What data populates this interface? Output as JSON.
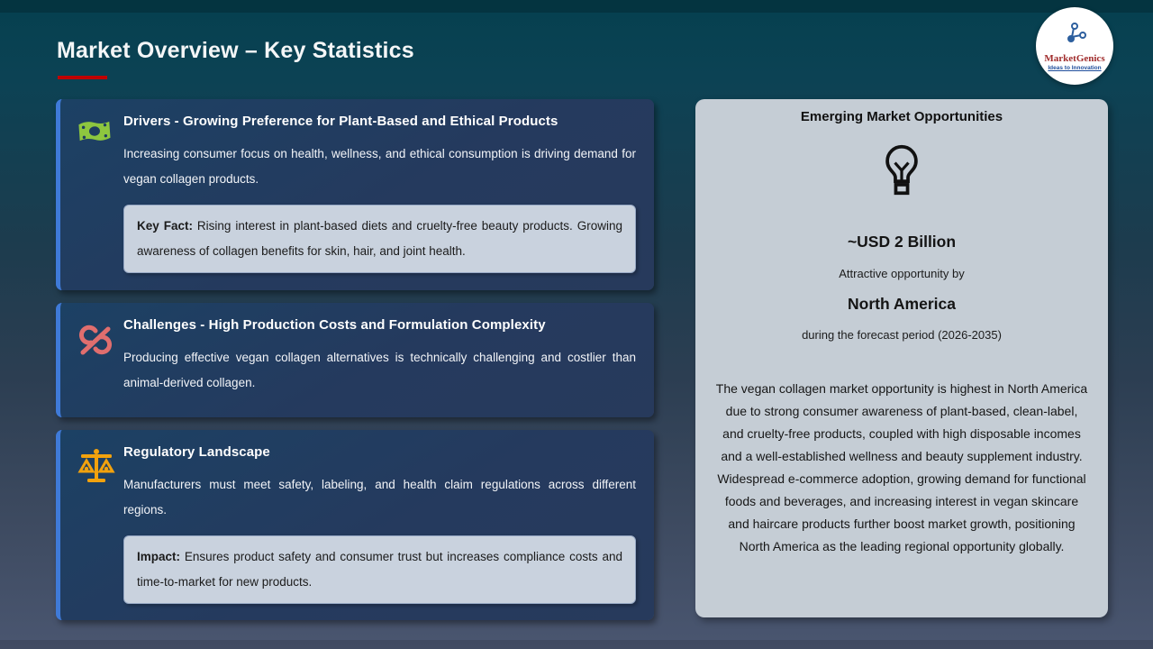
{
  "header": {
    "title": "Market Overview – Key Statistics",
    "logo_brand": "MarketGenics",
    "logo_tagline": "Ideas to Innovation"
  },
  "cards": [
    {
      "icon": "money-icon",
      "heading": "Drivers - Growing Preference for Plant-Based and Ethical Products",
      "body": "Increasing consumer focus on health, wellness, and ethical consumption is driving demand for vegan collagen products.",
      "callout_label": "Key Fact:",
      "callout_text": "Rising interest in plant-based diets and cruelty-free beauty products. Growing awareness of collagen benefits for skin, hair, and joint health."
    },
    {
      "icon": "unlink-icon",
      "heading": "Challenges - High Production Costs and Formulation Complexity",
      "body": "Producing effective vegan collagen alternatives is technically challenging and costlier than animal-derived collagen."
    },
    {
      "icon": "scales-icon",
      "heading": "Regulatory Landscape",
      "body": "Manufacturers must meet safety, labeling, and health claim regulations across different regions.",
      "callout_label": "Impact:",
      "callout_text": "Ensures product safety and consumer trust but increases compliance costs and time-to-market for new products."
    }
  ],
  "opportunity": {
    "heading": "Emerging Market Opportunities",
    "icon": "lightbulb-icon",
    "value": "~USD 2 Billion",
    "subtitle": "Attractive opportunity by",
    "region": "North America",
    "period": "during the forecast period (2026-2035)",
    "description": "The vegan collagen market opportunity is highest in North America due to strong consumer awareness of plant-based, clean-label, and cruelty-free products, coupled with high disposable incomes and a well-established wellness and beauty supplement industry. Widespread e-commerce adoption, growing demand for functional foods and beverages, and increasing interest in vegan skincare and haircare products further boost market growth, positioning North America as the leading regional opportunity globally."
  },
  "colors": {
    "background_top": "#05404f",
    "background_bottom": "#4a5670",
    "card_background": "#253a5e",
    "card_accent_border": "#3f7ad8",
    "callout_background": "#c9d2de",
    "panel_background": "#c5cdd5",
    "title_underline": "#c00000",
    "money_icon": "#8dc63f",
    "unlink_icon": "#e06e6e",
    "scales_icon": "#f2a20d",
    "lightbulb_icon": "#111111",
    "logo_brand_color": "#a02c2c",
    "logo_tagline_color": "#1f4e9c"
  }
}
